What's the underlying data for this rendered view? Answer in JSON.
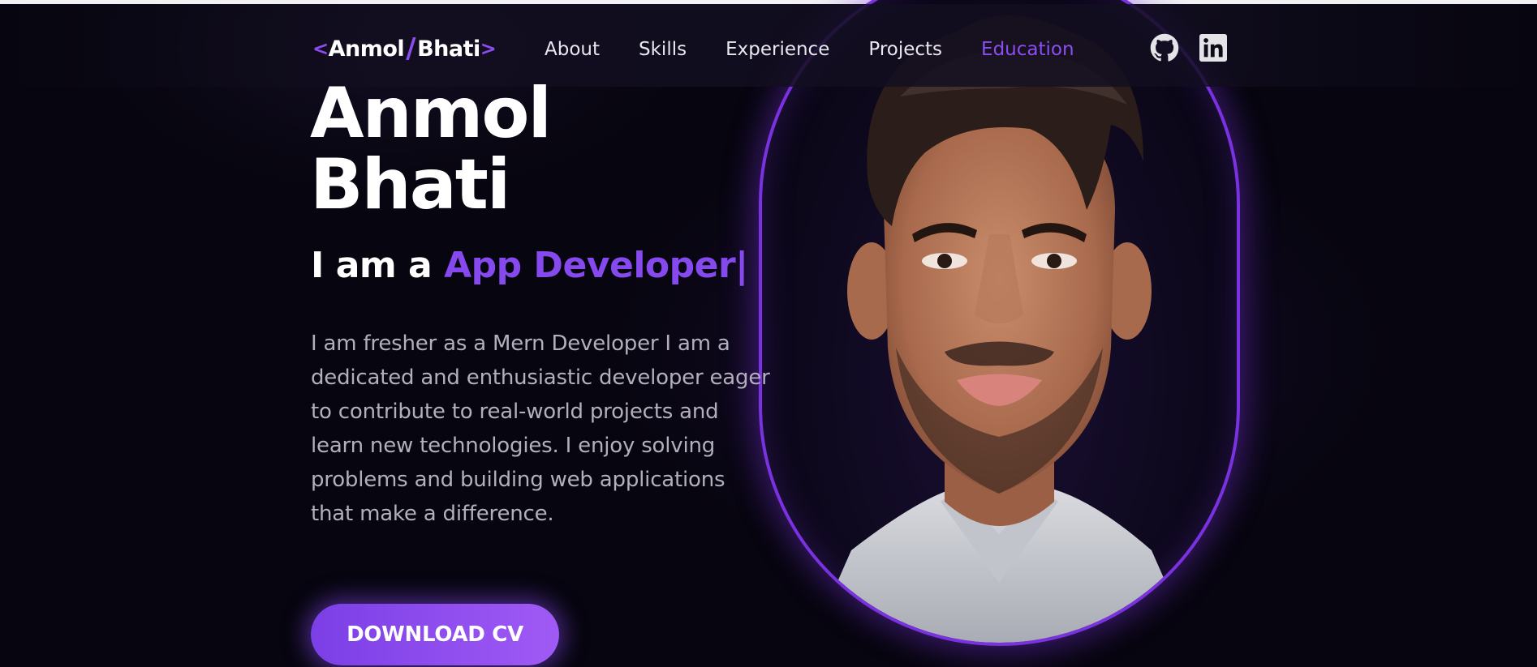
{
  "logo": {
    "open_bracket": "<",
    "first": "Anmol",
    "slash": "/",
    "last": "Bhati",
    "close_bracket": ">"
  },
  "nav": {
    "items": [
      {
        "label": "About",
        "active": false
      },
      {
        "label": "Skills",
        "active": false
      },
      {
        "label": "Experience",
        "active": false
      },
      {
        "label": "Projects",
        "active": false
      },
      {
        "label": "Education",
        "active": true
      }
    ],
    "social": [
      {
        "icon": "github-icon"
      },
      {
        "icon": "linkedin-icon"
      }
    ]
  },
  "hero": {
    "name_first": "Anmol",
    "name_last": "Bhati",
    "role_prefix": "I am a ",
    "role_word": "App Developer|",
    "description": "I am fresher as a Mern Developer I am a dedicated and enthusiastic developer eager to contribute to real-world projects and learn new technologies. I enjoy solving problems and building web applications that make a difference.",
    "cv_button": "DOWNLOAD CV"
  },
  "colors": {
    "accent": "#8549ee",
    "background": "#07050f",
    "frame": "#7a32e0",
    "text": "#ffffff",
    "muted_text": "#b3b0be"
  }
}
